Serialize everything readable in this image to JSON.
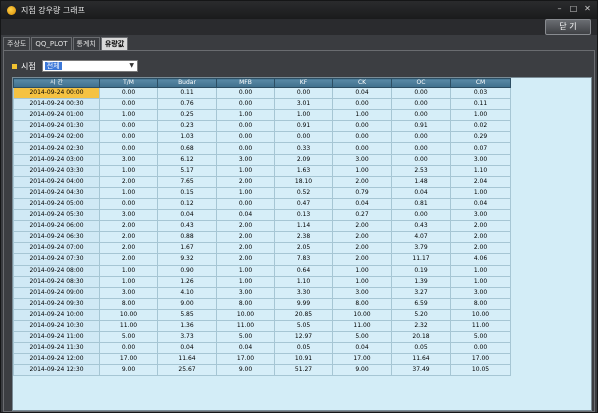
{
  "window": {
    "title": "지점 강우량 그래프",
    "close_label": "닫 기"
  },
  "tabs": [
    {
      "label": "주상도",
      "active": false
    },
    {
      "label": "QQ_PLOT",
      "active": false
    },
    {
      "label": "통계치",
      "active": false
    },
    {
      "label": "유량값",
      "active": true
    }
  ],
  "filter": {
    "label": "시점",
    "value": "전체"
  },
  "table": {
    "columns": [
      "시 간",
      "T/M",
      "Budar",
      "MFB",
      "KF",
      "CK",
      "OC",
      "CM"
    ],
    "rows": [
      [
        "2014-09-24 00:00",
        "0.00",
        "0.11",
        "0.00",
        "0.00",
        "0.04",
        "0.00",
        "0.03"
      ],
      [
        "2014-09-24 00:30",
        "0.00",
        "0.76",
        "0.00",
        "3.01",
        "0.00",
        "0.00",
        "0.11"
      ],
      [
        "2014-09-24 01:00",
        "1.00",
        "0.25",
        "1.00",
        "1.00",
        "1.00",
        "0.00",
        "1.00"
      ],
      [
        "2014-09-24 01:30",
        "0.00",
        "0.23",
        "0.00",
        "0.91",
        "0.00",
        "0.91",
        "0.02"
      ],
      [
        "2014-09-24 02:00",
        "0.00",
        "1.03",
        "0.00",
        "0.00",
        "0.00",
        "0.00",
        "0.29"
      ],
      [
        "2014-09-24 02:30",
        "0.00",
        "0.68",
        "0.00",
        "0.33",
        "0.00",
        "0.00",
        "0.07"
      ],
      [
        "2014-09-24 03:00",
        "3.00",
        "6.12",
        "3.00",
        "2.09",
        "3.00",
        "0.00",
        "3.00"
      ],
      [
        "2014-09-24 03:30",
        "1.00",
        "5.17",
        "1.00",
        "1.63",
        "1.00",
        "2.53",
        "1.10"
      ],
      [
        "2014-09-24 04:00",
        "2.00",
        "7.65",
        "2.00",
        "18.10",
        "2.00",
        "1.48",
        "2.04"
      ],
      [
        "2014-09-24 04:30",
        "1.00",
        "0.15",
        "1.00",
        "0.52",
        "0.79",
        "0.04",
        "1.00"
      ],
      [
        "2014-09-24 05:00",
        "0.00",
        "0.12",
        "0.00",
        "0.47",
        "0.04",
        "0.81",
        "0.04"
      ],
      [
        "2014-09-24 05:30",
        "3.00",
        "0.04",
        "0.04",
        "0.13",
        "0.27",
        "0.00",
        "3.00"
      ],
      [
        "2014-09-24 06:00",
        "2.00",
        "0.43",
        "2.00",
        "1.14",
        "2.00",
        "0.43",
        "2.00"
      ],
      [
        "2014-09-24 06:30",
        "2.00",
        "0.88",
        "2.00",
        "2.38",
        "2.00",
        "4.07",
        "2.00"
      ],
      [
        "2014-09-24 07:00",
        "2.00",
        "1.67",
        "2.00",
        "2.05",
        "2.00",
        "3.79",
        "2.00"
      ],
      [
        "2014-09-24 07:30",
        "2.00",
        "9.32",
        "2.00",
        "7.83",
        "2.00",
        "11.17",
        "4.06"
      ],
      [
        "2014-09-24 08:00",
        "1.00",
        "0.90",
        "1.00",
        "0.64",
        "1.00",
        "0.19",
        "1.00"
      ],
      [
        "2014-09-24 08:30",
        "1.00",
        "1.26",
        "1.00",
        "1.10",
        "1.00",
        "1.39",
        "1.00"
      ],
      [
        "2014-09-24 09:00",
        "3.00",
        "4.10",
        "3.00",
        "3.30",
        "3.00",
        "3.27",
        "3.00"
      ],
      [
        "2014-09-24 09:30",
        "8.00",
        "9.00",
        "8.00",
        "9.99",
        "8.00",
        "6.59",
        "8.00"
      ],
      [
        "2014-09-24 10:00",
        "10.00",
        "5.85",
        "10.00",
        "20.85",
        "10.00",
        "5.20",
        "10.00"
      ],
      [
        "2014-09-24 10:30",
        "11.00",
        "1.36",
        "11.00",
        "5.05",
        "11.00",
        "2.32",
        "11.00"
      ],
      [
        "2014-09-24 11:00",
        "5.00",
        "3.73",
        "5.00",
        "12.97",
        "5.00",
        "20.18",
        "5.00"
      ],
      [
        "2014-09-24 11:30",
        "0.00",
        "0.04",
        "0.04",
        "0.05",
        "0.04",
        "0.05",
        "0.00"
      ],
      [
        "2014-09-24 12:00",
        "17.00",
        "11.64",
        "17.00",
        "10.91",
        "17.00",
        "11.64",
        "17.00"
      ],
      [
        "2014-09-24 12:30",
        "9.00",
        "25.67",
        "9.00",
        "51.27",
        "9.00",
        "37.49",
        "10.05"
      ]
    ]
  }
}
